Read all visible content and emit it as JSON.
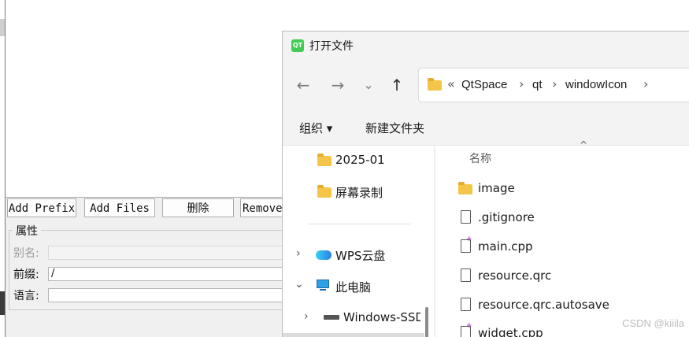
{
  "resource_editor": {
    "buttons": {
      "add_prefix": "Add Prefix",
      "add_files": "Add Files",
      "delete": "删除",
      "remove": "Remove"
    },
    "properties": {
      "group_title": "属性",
      "alias_label": "别名:",
      "alias_value": "",
      "prefix_label": "前缀:",
      "prefix_value": "/",
      "language_label": "语言:",
      "language_value": ""
    }
  },
  "file_dialog": {
    "app_icon": "qt-logo-icon",
    "app_icon_text": "QT",
    "title": "打开文件",
    "nav": {
      "back": "←",
      "forward": "→",
      "recent": "⌄",
      "up": "↑"
    },
    "breadcrumb": {
      "overflow": "«",
      "items": [
        "QtSpace",
        "qt",
        "windowIcon"
      ],
      "separator": "›"
    },
    "commands": {
      "organize": "组织 ▾",
      "new_folder": "新建文件夹"
    },
    "nav_pane": {
      "items": [
        {
          "label": "2025-01",
          "icon": "folder-icon"
        },
        {
          "label": "屏幕录制",
          "icon": "folder-icon"
        },
        {
          "label": "WPS云盘",
          "icon": "cloud-icon",
          "expander": "›"
        },
        {
          "label": "此电脑",
          "icon": "computer-icon",
          "expander": "⌄"
        },
        {
          "label": "Windows-SSD",
          "icon": "drive-icon",
          "expander": "›"
        }
      ]
    },
    "file_list": {
      "column_name": "名称",
      "sort_indicator": "^",
      "files": [
        {
          "name": "image",
          "type": "folder"
        },
        {
          "name": ".gitignore",
          "type": "file"
        },
        {
          "name": "main.cpp",
          "type": "cpp"
        },
        {
          "name": "resource.qrc",
          "type": "file"
        },
        {
          "name": "resource.qrc.autosave",
          "type": "file"
        },
        {
          "name": "widget.cpp",
          "type": "cpp"
        }
      ]
    }
  },
  "watermark": "CSDN @kiiila"
}
